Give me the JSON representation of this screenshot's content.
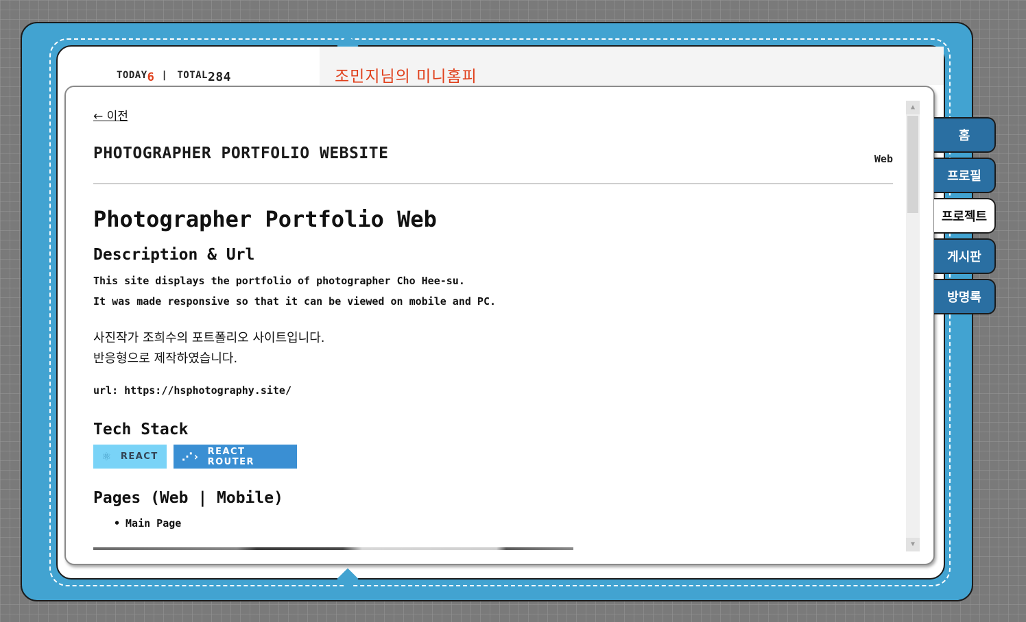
{
  "counter": {
    "today_label": "TODAY",
    "today_value": "6",
    "separator": "|",
    "total_label": "TOTAL",
    "total_value": "284"
  },
  "home_title": "조민지님의 미니홈피",
  "nav_tabs": [
    {
      "label": "홈",
      "active": false
    },
    {
      "label": "프로필",
      "active": false
    },
    {
      "label": "프로젝트",
      "active": true
    },
    {
      "label": "게시판",
      "active": false
    },
    {
      "label": "방명록",
      "active": false
    }
  ],
  "project": {
    "back_label": "← 이전",
    "header_title": "PHOTOGRAPHER PORTFOLIO WEBSITE",
    "category": "Web",
    "h1": "Photographer Portfolio Web",
    "desc_heading": "Description & Url",
    "desc_en_1": "This site displays the portfolio of photographer Cho Hee-su.",
    "desc_en_2": "It was made responsive so that it can be viewed on mobile and PC.",
    "desc_ko_1": "사진작가 조희수의 포트폴리오 사이트입니다.",
    "desc_ko_2": "반응형으로 제작하였습니다.",
    "url_line": "url: https://hsphotography.site/",
    "tech_heading": "Tech Stack",
    "tech_badges": [
      {
        "label": "REACT",
        "icon": "react-atom-icon",
        "color": "#79d3f7"
      },
      {
        "label": "REACT ROUTER",
        "icon": "react-router-icon",
        "color": "#3a8fd3"
      }
    ],
    "pages_heading": "Pages (Web | Mobile)",
    "pages": [
      "Main Page"
    ]
  },
  "colors": {
    "frame": "#42a3d1",
    "tab": "#2a6fa2",
    "accent": "#e0401c"
  }
}
